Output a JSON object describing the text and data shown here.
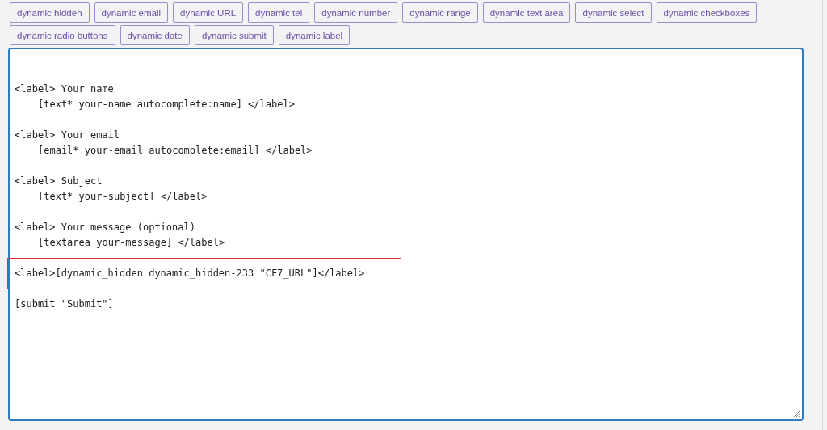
{
  "tag_buttons": [
    "dynamic hidden",
    "dynamic email",
    "dynamic URL",
    "dynamic tel",
    "dynamic number",
    "dynamic range",
    "dynamic text area",
    "dynamic select",
    "dynamic checkboxes",
    "dynamic radio buttons",
    "dynamic date",
    "dynamic submit",
    "dynamic label"
  ],
  "editor": {
    "blocks": [
      {
        "highlighted": false,
        "lines": [
          {
            "text": "<label> Your name",
            "indented": false
          },
          {
            "text": "[text* your-name autocomplete:name] </label>",
            "indented": true
          }
        ]
      },
      {
        "highlighted": false,
        "lines": [
          {
            "text": "<label> Your email",
            "indented": false
          },
          {
            "text": "[email* your-email autocomplete:email] </label>",
            "indented": true
          }
        ]
      },
      {
        "highlighted": false,
        "lines": [
          {
            "text": "<label> Subject",
            "indented": false
          },
          {
            "text": "[text* your-subject] </label>",
            "indented": true
          }
        ]
      },
      {
        "highlighted": false,
        "lines": [
          {
            "text": "<label> Your message (optional)",
            "indented": false
          },
          {
            "text": "[textarea your-message] </label>",
            "indented": true
          }
        ]
      },
      {
        "highlighted": true,
        "lines": [
          {
            "text": "<label>[dynamic_hidden dynamic_hidden-233 \"CF7_URL\"]</label>",
            "indented": false
          }
        ]
      },
      {
        "highlighted": false,
        "lines": [
          {
            "text": "[submit \"Submit\"]",
            "indented": false
          }
        ]
      }
    ]
  }
}
